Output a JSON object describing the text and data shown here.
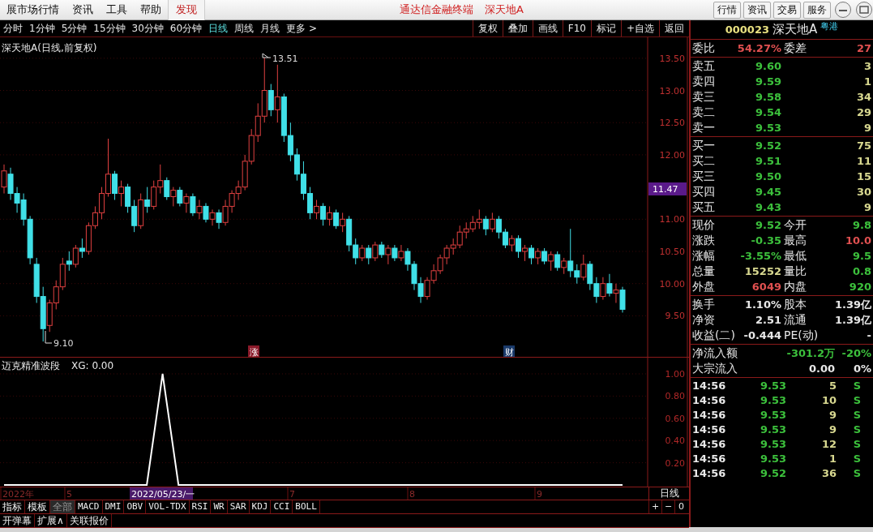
{
  "menu_bar": {
    "items": [
      {
        "label": "展市场行情",
        "selected": false
      },
      {
        "label": "资讯",
        "selected": false
      },
      {
        "label": "工具",
        "selected": false
      },
      {
        "label": "帮助",
        "selected": false
      },
      {
        "label": "发现",
        "selected": true
      }
    ],
    "app_title": "通达信金融终端",
    "stock_title": "深天地A",
    "buttons": [
      "行情",
      "资讯",
      "交易",
      "服务"
    ]
  },
  "periods": [
    {
      "label": "分时",
      "selected": false
    },
    {
      "label": "1分钟",
      "selected": false
    },
    {
      "label": "5分钟",
      "selected": false
    },
    {
      "label": "15分钟",
      "selected": false
    },
    {
      "label": "30分钟",
      "selected": false
    },
    {
      "label": "60分钟",
      "selected": false
    },
    {
      "label": "日线",
      "selected": true
    },
    {
      "label": "周线",
      "selected": false
    },
    {
      "label": "月线",
      "selected": false
    },
    {
      "label": "更多 >",
      "selected": false
    }
  ],
  "chart_tools": [
    "复权",
    "叠加",
    "画线",
    "F10",
    "标记",
    "+自选",
    "返回"
  ],
  "price_chart": {
    "title": "深天地A(日线,前复权)",
    "current_price": "11.47",
    "high_marker": "13.51",
    "low_marker": "9.10",
    "chart_data": {
      "type": "candlestick",
      "grid": true,
      "ylim": [
        8.85,
        13.8
      ],
      "yticks": [
        {
          "value": 9.5,
          "label": "9.50"
        },
        {
          "value": 10,
          "label": "10.00"
        },
        {
          "value": 10.5,
          "label": "10.50"
        },
        {
          "value": 11,
          "label": "11.00"
        },
        {
          "value": 12,
          "label": "12.00"
        },
        {
          "value": 12.5,
          "label": "12.50"
        },
        {
          "value": 13,
          "label": "13.00"
        },
        {
          "value": 13.5,
          "label": "13.50"
        }
      ],
      "ohlc": [
        [
          11.5,
          11.85,
          11.4,
          11.75
        ],
        [
          11.7,
          11.8,
          11.3,
          11.4
        ],
        [
          11.4,
          11.5,
          11.1,
          11.25
        ],
        [
          11.3,
          11.4,
          10.9,
          11.0
        ],
        [
          11.0,
          11.05,
          10.3,
          10.4
        ],
        [
          10.3,
          10.4,
          9.7,
          9.8
        ],
        [
          9.8,
          9.95,
          9.1,
          9.3
        ],
        [
          9.35,
          9.75,
          9.25,
          9.7
        ],
        [
          9.7,
          10.05,
          9.6,
          9.95
        ],
        [
          9.95,
          10.4,
          9.9,
          10.3
        ],
        [
          10.35,
          10.5,
          10.2,
          10.3
        ],
        [
          10.3,
          10.6,
          10.25,
          10.55
        ],
        [
          10.55,
          10.7,
          10.4,
          10.5
        ],
        [
          10.5,
          10.95,
          10.45,
          10.9
        ],
        [
          10.9,
          11.2,
          10.85,
          11.1
        ],
        [
          11.1,
          11.5,
          11.0,
          11.4
        ],
        [
          11.4,
          12.25,
          11.35,
          11.7
        ],
        [
          11.7,
          11.75,
          11.3,
          11.4
        ],
        [
          11.4,
          11.6,
          11.2,
          11.5
        ],
        [
          11.5,
          11.55,
          11.1,
          11.2
        ],
        [
          11.2,
          11.3,
          10.8,
          10.9
        ],
        [
          10.9,
          11.4,
          10.85,
          11.3
        ],
        [
          11.3,
          11.5,
          11.1,
          11.2
        ],
        [
          11.2,
          11.6,
          11.15,
          11.5
        ],
        [
          11.5,
          11.85,
          11.4,
          11.6
        ],
        [
          11.6,
          11.65,
          11.3,
          11.35
        ],
        [
          11.35,
          11.5,
          11.2,
          11.45
        ],
        [
          11.45,
          11.5,
          11.2,
          11.25
        ],
        [
          11.25,
          11.4,
          11.1,
          11.35
        ],
        [
          11.35,
          11.4,
          11.05,
          11.1
        ],
        [
          11.1,
          11.3,
          11.0,
          11.2
        ],
        [
          11.2,
          11.25,
          10.95,
          11.0
        ],
        [
          11.0,
          11.15,
          10.9,
          11.1
        ],
        [
          11.1,
          11.15,
          10.85,
          10.95
        ],
        [
          10.95,
          11.3,
          10.9,
          11.2
        ],
        [
          11.2,
          11.45,
          11.1,
          11.4
        ],
        [
          11.4,
          11.6,
          11.3,
          11.5
        ],
        [
          11.5,
          12.0,
          11.45,
          11.9
        ],
        [
          11.9,
          12.4,
          11.85,
          12.3
        ],
        [
          12.3,
          12.8,
          12.2,
          12.6
        ],
        [
          12.6,
          13.51,
          12.5,
          13.0
        ],
        [
          13.0,
          13.1,
          12.6,
          12.7
        ],
        [
          12.7,
          13.4,
          12.5,
          12.9
        ],
        [
          12.9,
          12.95,
          12.2,
          12.3
        ],
        [
          12.3,
          12.5,
          11.9,
          12.0
        ],
        [
          12.0,
          12.1,
          11.6,
          11.7
        ],
        [
          11.7,
          11.9,
          11.3,
          11.4
        ],
        [
          11.4,
          11.5,
          11.0,
          11.1
        ],
        [
          11.1,
          11.3,
          11.0,
          11.2
        ],
        [
          11.2,
          11.25,
          10.9,
          11.0
        ],
        [
          11.0,
          11.2,
          10.9,
          11.1
        ],
        [
          11.1,
          11.15,
          10.85,
          10.9
        ],
        [
          10.9,
          11.1,
          10.8,
          11.0
        ],
        [
          11.0,
          11.05,
          10.5,
          10.6
        ],
        [
          10.6,
          10.7,
          10.3,
          10.4
        ],
        [
          10.4,
          10.6,
          10.35,
          10.55
        ],
        [
          10.55,
          10.6,
          10.3,
          10.4
        ],
        [
          10.4,
          10.65,
          10.35,
          10.6
        ],
        [
          10.6,
          10.65,
          10.4,
          10.45
        ],
        [
          10.45,
          10.6,
          10.3,
          10.55
        ],
        [
          10.55,
          10.6,
          10.35,
          10.4
        ],
        [
          10.4,
          10.6,
          10.35,
          10.5
        ],
        [
          10.5,
          10.55,
          10.2,
          10.3
        ],
        [
          10.3,
          10.35,
          9.9,
          10.0
        ],
        [
          10.0,
          10.1,
          9.7,
          9.8
        ],
        [
          9.8,
          10.1,
          9.75,
          10.05
        ],
        [
          10.05,
          10.3,
          10.0,
          10.2
        ],
        [
          10.2,
          10.45,
          10.15,
          10.4
        ],
        [
          10.4,
          10.6,
          10.3,
          10.55
        ],
        [
          10.55,
          10.7,
          10.45,
          10.6
        ],
        [
          10.6,
          10.9,
          10.55,
          10.8
        ],
        [
          10.8,
          10.95,
          10.7,
          10.85
        ],
        [
          10.85,
          11.05,
          10.8,
          10.95
        ],
        [
          10.95,
          11.15,
          10.85,
          11.0
        ],
        [
          11.0,
          11.05,
          10.75,
          10.85
        ],
        [
          10.85,
          11.1,
          10.8,
          11.0
        ],
        [
          11.0,
          11.05,
          10.7,
          10.8
        ],
        [
          10.8,
          10.85,
          10.55,
          10.6
        ],
        [
          10.6,
          10.75,
          10.5,
          10.7
        ],
        [
          10.7,
          10.75,
          10.4,
          10.5
        ],
        [
          10.5,
          10.6,
          10.35,
          10.55
        ],
        [
          10.55,
          10.6,
          10.3,
          10.4
        ],
        [
          10.4,
          10.55,
          10.3,
          10.5
        ],
        [
          10.5,
          10.55,
          10.3,
          10.35
        ],
        [
          10.35,
          10.5,
          10.2,
          10.45
        ],
        [
          10.45,
          10.5,
          10.2,
          10.25
        ],
        [
          10.25,
          10.4,
          10.15,
          10.35
        ],
        [
          10.35,
          10.85,
          10.1,
          10.2
        ],
        [
          10.2,
          10.3,
          10.0,
          10.1
        ],
        [
          10.1,
          10.45,
          10.05,
          10.3
        ],
        [
          10.3,
          10.35,
          9.9,
          10.0
        ],
        [
          10.0,
          10.1,
          9.7,
          9.8
        ],
        [
          9.8,
          10.1,
          9.75,
          10.0
        ],
        [
          10.0,
          10.15,
          9.8,
          9.85
        ],
        [
          9.85,
          10.0,
          9.7,
          9.9
        ],
        [
          9.9,
          9.95,
          9.55,
          9.6
        ]
      ]
    },
    "event_markers": [
      {
        "label": "涨",
        "color": "#8a1a2a"
      },
      {
        "label": "财",
        "color": "#1a3a6a"
      }
    ]
  },
  "indicator": {
    "title": "迈克精准波段",
    "reading": ": 0.00",
    "chart_data": {
      "type": "line",
      "grid": true,
      "ylim": [
        0,
        1
      ],
      "yticks": [
        {
          "value": 0.2,
          "label": "0.20"
        },
        {
          "value": 0.4,
          "label": "0.40"
        },
        {
          "value": 0.6,
          "label": "0.60"
        },
        {
          "value": 0.8,
          "label": "0.80"
        },
        {
          "value": 1,
          "label": "1.00"
        }
      ],
      "series": [
        {
          "name": "XG",
          "color": "#ffffff",
          "values": [
            0,
            0,
            0,
            0,
            0,
            0,
            0,
            0,
            0,
            0,
            1,
            0,
            0,
            0,
            0,
            0,
            0,
            0,
            0,
            0,
            0,
            0,
            0,
            0,
            0,
            0,
            0,
            0,
            0,
            0,
            0,
            0,
            0,
            0,
            0,
            0,
            0,
            0,
            0,
            0
          ]
        }
      ]
    }
  },
  "date_axis": {
    "labels": [
      "2022年",
      "5",
      "7",
      "8",
      "9"
    ],
    "cursor_date": "2022/05/23/一",
    "period": "日线"
  },
  "indicator_tabs": [
    {
      "label": "指标",
      "selected": false
    },
    {
      "label": "模板",
      "selected": false
    },
    {
      "label": "全部",
      "selected": true
    },
    {
      "label": "MACD",
      "selected": false
    },
    {
      "label": "DMI",
      "selected": false
    },
    {
      "label": "OBV",
      "selected": false
    },
    {
      "label": "VOL-TDX",
      "selected": false
    },
    {
      "label": "RSI",
      "selected": false
    },
    {
      "label": "WR",
      "selected": false
    },
    {
      "label": "SAR",
      "selected": false
    },
    {
      "label": "KDJ",
      "selected": false
    },
    {
      "label": "CCI",
      "selected": false
    },
    {
      "label": "BOLL",
      "selected": false
    }
  ],
  "zoom_buttons": [
    "+",
    "−",
    "0"
  ],
  "extra_buttons": [
    "开弹幕",
    "扩展∧",
    "关联报价"
  ],
  "quote": {
    "code": "000023",
    "name": "深天地A",
    "tag": "粤港",
    "order_ratio": {
      "cells": [
        {
          "label": "委比",
          "value": "54.27%",
          "color": "#e05050"
        },
        {
          "label": "委差",
          "value": "27",
          "color": "#e05050"
        }
      ]
    },
    "asks": [
      {
        "label": "卖五",
        "price": "9.60",
        "volume": "3"
      },
      {
        "label": "卖四",
        "price": "9.59",
        "volume": "1"
      },
      {
        "label": "卖三",
        "price": "9.58",
        "volume": "34"
      },
      {
        "label": "卖二",
        "price": "9.54",
        "volume": "29"
      },
      {
        "label": "卖一",
        "price": "9.53",
        "volume": "9"
      }
    ],
    "bids": [
      {
        "label": "买一",
        "price": "9.52",
        "volume": "75"
      },
      {
        "label": "买二",
        "price": "9.51",
        "volume": "11"
      },
      {
        "label": "买三",
        "price": "9.50",
        "volume": "15"
      },
      {
        "label": "买四",
        "price": "9.45",
        "volume": "30"
      },
      {
        "label": "买五",
        "price": "9.43",
        "volume": "9"
      }
    ],
    "stats": [
      {
        "cells": [
          {
            "label": "现价",
            "value": "9.52",
            "color": "#3cc03c"
          },
          {
            "label": "今开",
            "value": "9.8",
            "color": "#3cc03c"
          }
        ]
      },
      {
        "cells": [
          {
            "label": "涨跌",
            "value": "-0.35",
            "color": "#3cc03c"
          },
          {
            "label": "最高",
            "value": "10.0",
            "color": "#e05050"
          }
        ]
      },
      {
        "cells": [
          {
            "label": "涨幅",
            "value": "-3.55%",
            "color": "#3cc03c"
          },
          {
            "label": "最低",
            "value": "9.5",
            "color": "#3cc03c"
          }
        ]
      },
      {
        "cells": [
          {
            "label": "总量",
            "value": "15252",
            "color": "#d8d890"
          },
          {
            "label": "量比",
            "value": "0.8",
            "color": "#3cc03c"
          }
        ]
      },
      {
        "cells": [
          {
            "label": "外盘",
            "value": "6049",
            "color": "#e05050"
          },
          {
            "label": "内盘",
            "value": "920",
            "color": "#3cc03c"
          }
        ]
      }
    ],
    "fundamentals": [
      {
        "cells": [
          {
            "label": "换手",
            "value": "1.10%",
            "color": "#e8e8e8"
          },
          {
            "label": "股本",
            "value": "1.39亿",
            "color": "#e8e8e8"
          }
        ]
      },
      {
        "cells": [
          {
            "label": "净资",
            "value": "2.51",
            "color": "#e8e8e8"
          },
          {
            "label": "流通",
            "value": "1.39亿",
            "color": "#e8e8e8"
          }
        ]
      },
      {
        "cells": [
          {
            "label": "收益(二)",
            "value": "-0.444",
            "color": "#e8e8e8"
          },
          {
            "label": "PE(动)",
            "value": "-",
            "color": "#e8e8e8"
          }
        ]
      }
    ],
    "flows": [
      {
        "cells": [
          {
            "label": "净流入额",
            "value": "-301.2万",
            "color": "#3cc03c"
          },
          {
            "value": "-20%",
            "color": "#3cc03c"
          }
        ]
      },
      {
        "cells": [
          {
            "label": "大宗流入",
            "value": "0.00",
            "color": "#e8e8e8"
          },
          {
            "value": "0%",
            "color": "#e8e8e8"
          }
        ]
      }
    ],
    "ticks": [
      {
        "time": "14:56",
        "price": "9.53",
        "volume": "5",
        "side": "S"
      },
      {
        "time": "14:56",
        "price": "9.53",
        "volume": "10",
        "side": "S"
      },
      {
        "time": "14:56",
        "price": "9.53",
        "volume": "9",
        "side": "S"
      },
      {
        "time": "14:56",
        "price": "9.53",
        "volume": "9",
        "side": "S"
      },
      {
        "time": "14:56",
        "price": "9.53",
        "volume": "12",
        "side": "S"
      },
      {
        "time": "14:56",
        "price": "9.53",
        "volume": "1",
        "side": "S"
      },
      {
        "time": "14:56",
        "price": "9.52",
        "volume": "36",
        "side": "S"
      }
    ]
  }
}
